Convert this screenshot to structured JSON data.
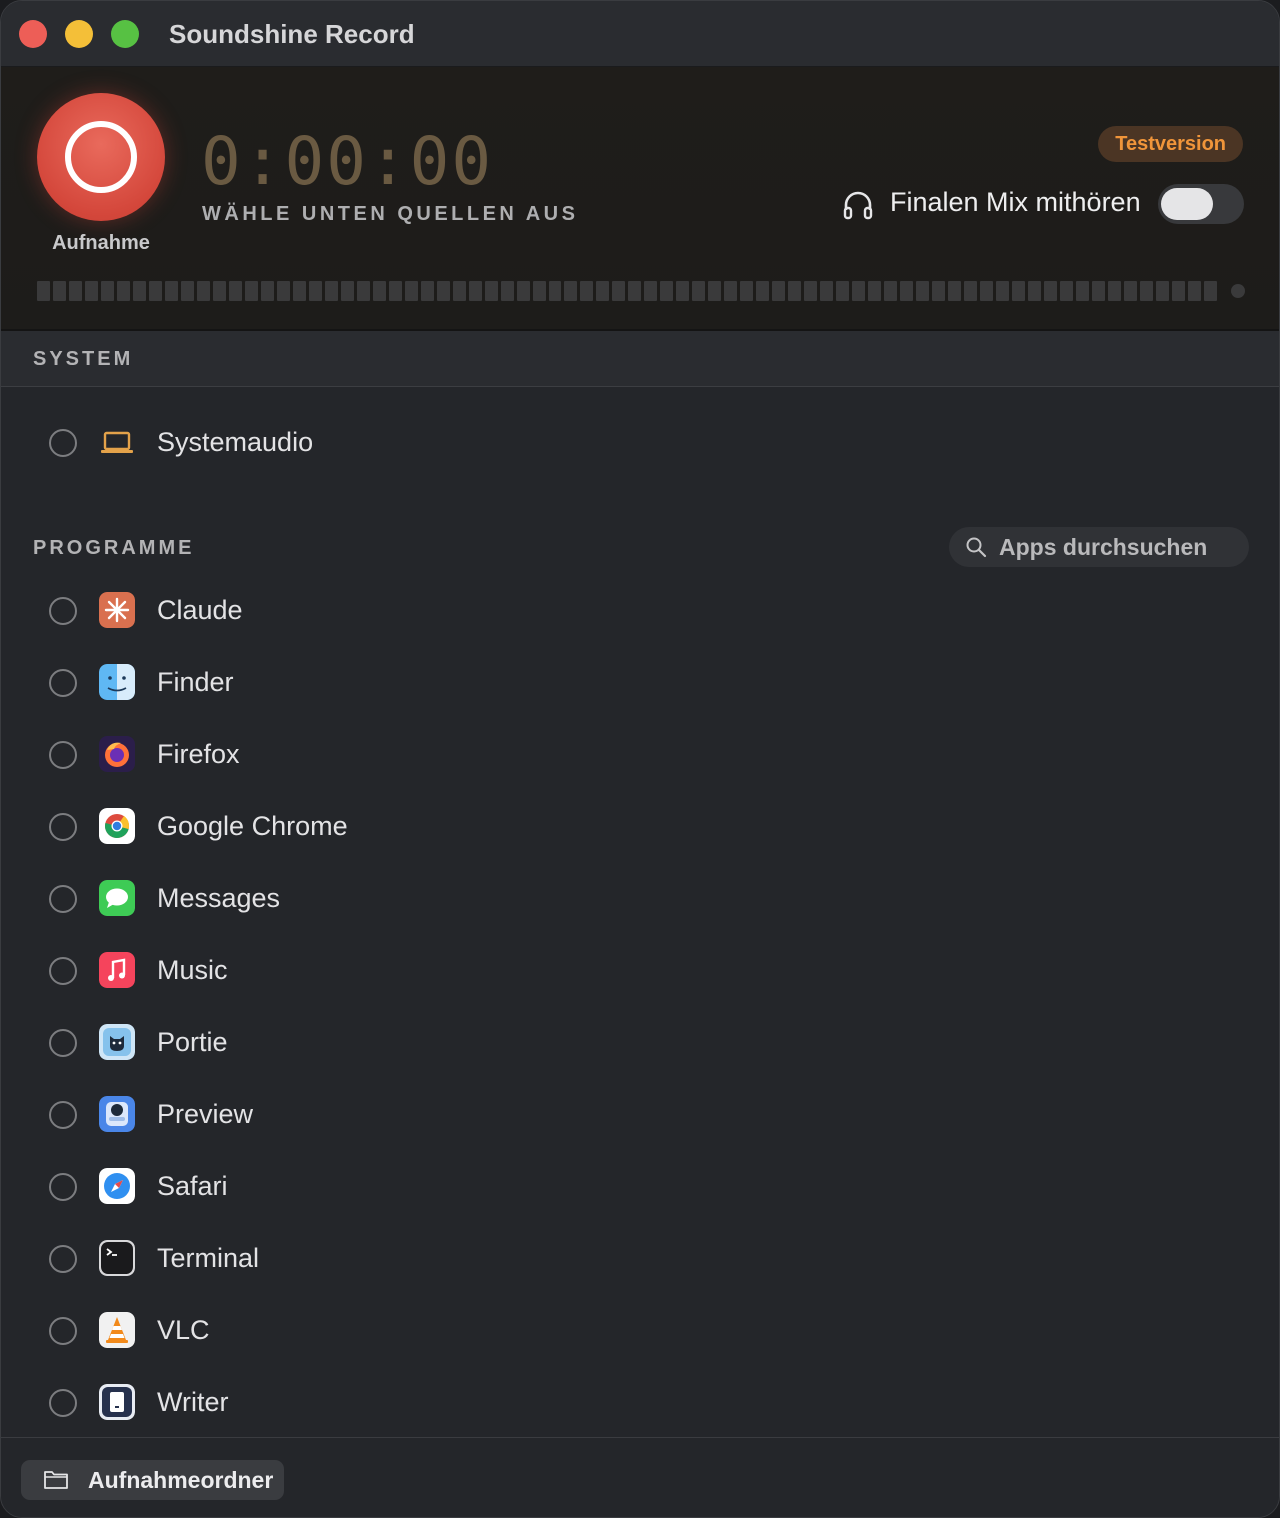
{
  "window": {
    "title": "Soundshine Record"
  },
  "header": {
    "record_label": "Aufnahme",
    "timer": "0:00:00",
    "subtitle": "WÄHLE UNTEN QUELLEN AUS",
    "badge": "Testversion",
    "mix_label": "Finalen Mix mithören",
    "mix_enabled": false
  },
  "system": {
    "title": "SYSTEM",
    "items": [
      {
        "label": "Systemaudio",
        "icon": "laptop-icon",
        "selected": false
      }
    ]
  },
  "programs": {
    "title": "PROGRAMME",
    "search_placeholder": "Apps durchsuchen",
    "items": [
      {
        "label": "Claude",
        "icon": "claude-icon",
        "selected": false
      },
      {
        "label": "Finder",
        "icon": "finder-icon",
        "selected": false
      },
      {
        "label": "Firefox",
        "icon": "firefox-icon",
        "selected": false
      },
      {
        "label": "Google Chrome",
        "icon": "chrome-icon",
        "selected": false
      },
      {
        "label": "Messages",
        "icon": "messages-icon",
        "selected": false
      },
      {
        "label": "Music",
        "icon": "music-icon",
        "selected": false
      },
      {
        "label": "Portie",
        "icon": "portie-icon",
        "selected": false
      },
      {
        "label": "Preview",
        "icon": "preview-icon",
        "selected": false
      },
      {
        "label": "Safari",
        "icon": "safari-icon",
        "selected": false
      },
      {
        "label": "Terminal",
        "icon": "terminal-icon",
        "selected": false
      },
      {
        "label": "VLC",
        "icon": "vlc-icon",
        "selected": false
      },
      {
        "label": "Writer",
        "icon": "writer-icon",
        "selected": false
      }
    ]
  },
  "footer": {
    "folder_label": "Aufnahmeordner"
  },
  "colors": {
    "accent_red": "#d4473b",
    "badge_orange": "#f0953a",
    "timer": "#6a5a42"
  }
}
